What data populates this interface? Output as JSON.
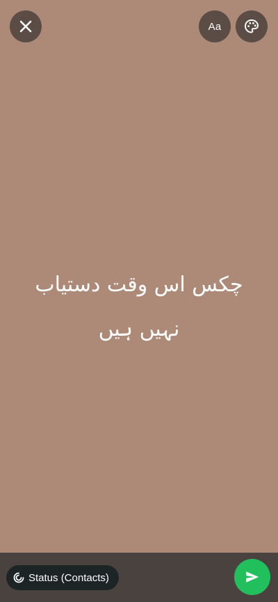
{
  "colors": {
    "background": "#AD8A77",
    "top_button_bg": "#3C3432",
    "bottom_bar": "#4A423E",
    "audience_pill": "#1D2426",
    "send_button": "#22C05D",
    "text": "#FFFFFF"
  },
  "toolbar": {
    "close_icon": "close-icon",
    "font_label": "Aa",
    "palette_icon": "palette-icon"
  },
  "status": {
    "text": "چکس اس وقت دستیاب نہیں ہیں"
  },
  "bottom": {
    "audience_icon": "status-ring-icon",
    "audience_label": "Status (Contacts)",
    "send_icon": "send-icon"
  }
}
